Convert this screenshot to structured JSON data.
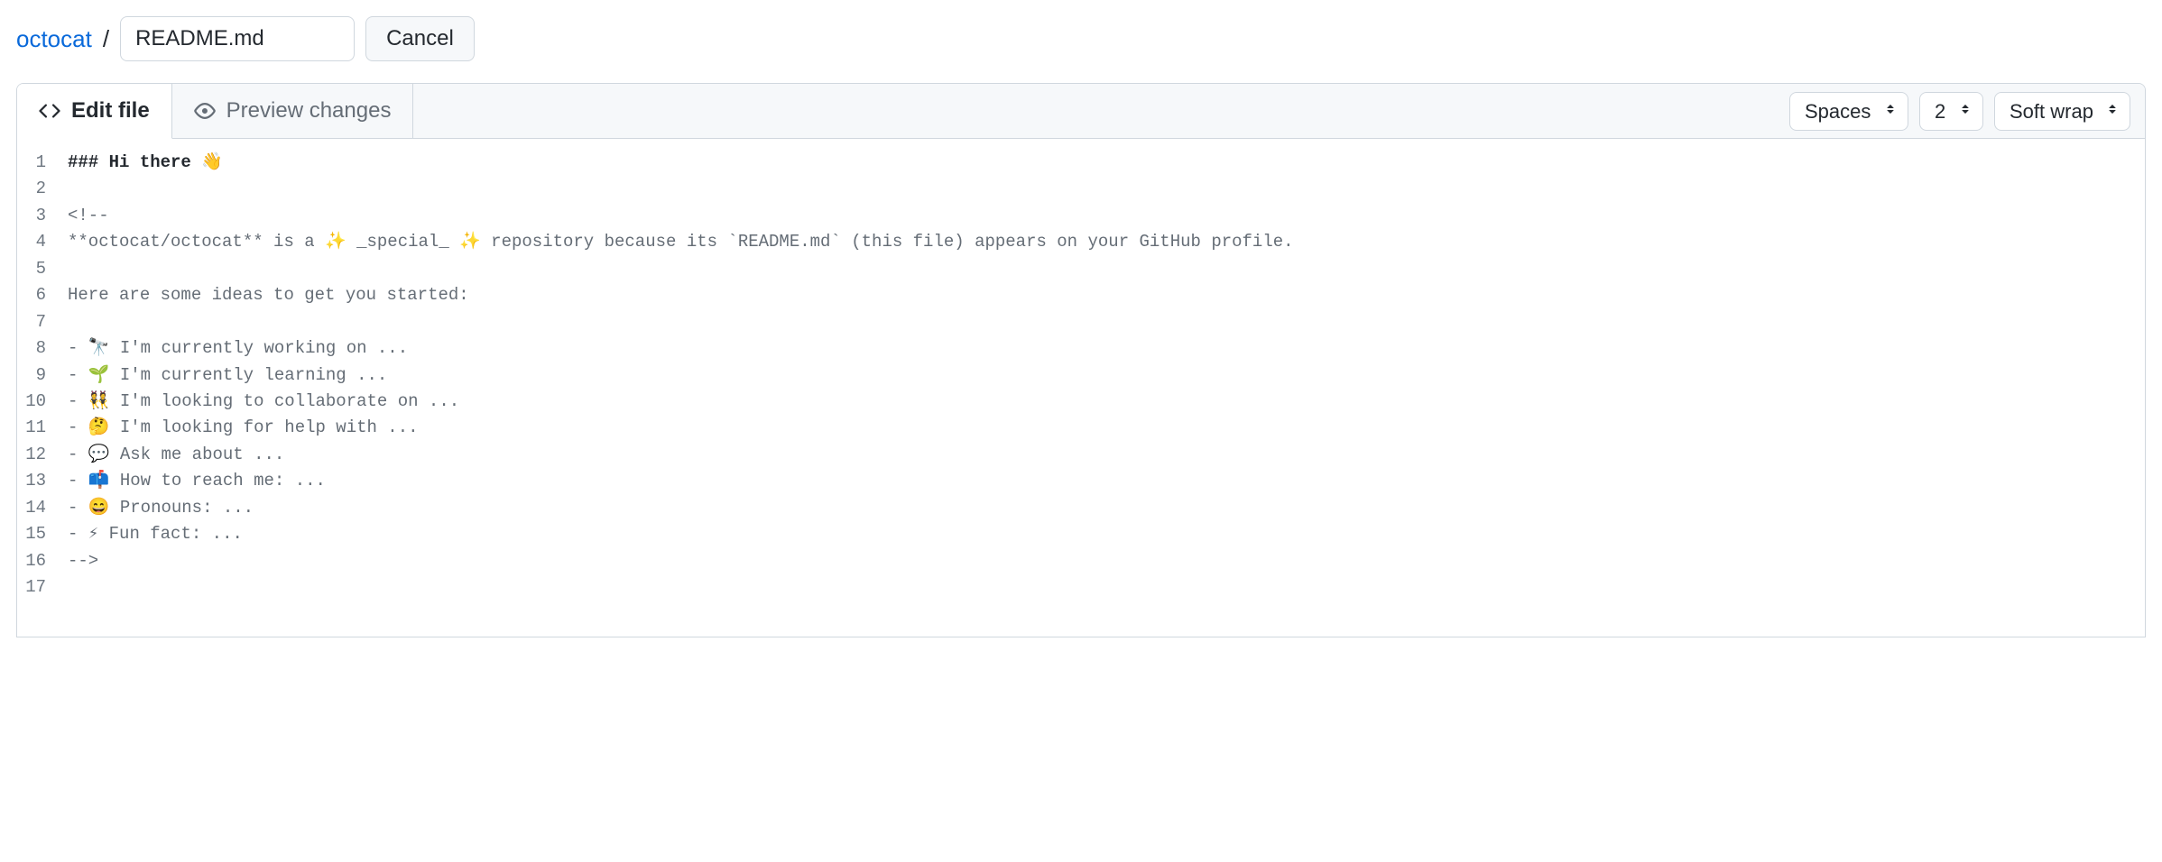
{
  "breadcrumb": {
    "owner": "octocat",
    "slash": "/"
  },
  "filename_input": {
    "value": "README.md"
  },
  "cancel_button": {
    "label": "Cancel"
  },
  "tabs": {
    "edit": "Edit file",
    "preview": "Preview changes"
  },
  "toolbar": {
    "indent_mode": "Spaces",
    "indent_size": "2",
    "wrap_mode": "Soft wrap"
  },
  "editor": {
    "lines": [
      {
        "n": "1",
        "text": "### Hi there 👋",
        "bold": true
      },
      {
        "n": "2",
        "text": ""
      },
      {
        "n": "3",
        "text": "<!--"
      },
      {
        "n": "4",
        "text": "**octocat/octocat** is a ✨ _special_ ✨ repository because its `README.md` (this file) appears on your GitHub profile."
      },
      {
        "n": "5",
        "text": ""
      },
      {
        "n": "6",
        "text": "Here are some ideas to get you started:"
      },
      {
        "n": "7",
        "text": ""
      },
      {
        "n": "8",
        "text": "- 🔭 I'm currently working on ..."
      },
      {
        "n": "9",
        "text": "- 🌱 I'm currently learning ..."
      },
      {
        "n": "10",
        "text": "- 👯 I'm looking to collaborate on ..."
      },
      {
        "n": "11",
        "text": "- 🤔 I'm looking for help with ..."
      },
      {
        "n": "12",
        "text": "- 💬 Ask me about ..."
      },
      {
        "n": "13",
        "text": "- 📫 How to reach me: ..."
      },
      {
        "n": "14",
        "text": "- 😄 Pronouns: ..."
      },
      {
        "n": "15",
        "text": "- ⚡ Fun fact: ..."
      },
      {
        "n": "16",
        "text": "-->"
      },
      {
        "n": "17",
        "text": ""
      }
    ]
  }
}
